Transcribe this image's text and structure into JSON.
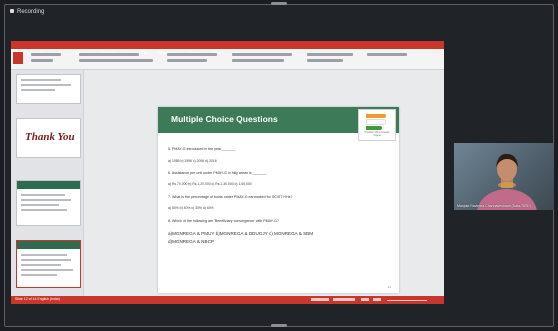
{
  "meeting": {
    "title": "Recording"
  },
  "app": {
    "ribbon_tabs": [
      "File",
      "Home",
      "Insert",
      "Design",
      "Transitions",
      "Animations",
      "Slide Show",
      "Review",
      "View",
      "Help"
    ],
    "status_text": "Slide 12 of 14   English (India)",
    "thanks_text": "Thank You"
  },
  "slide": {
    "title": "Multiple Choice Questions",
    "logo_text": "Pradhan Mantri Awaas Yojana",
    "questions": [
      {
        "text": "5. PMAY-G introduced in the year_______",
        "type": "q"
      },
      {
        "text": "a) 1985  b) 1996  c) 2006  d) 2016",
        "type": "opt"
      },
      {
        "text": "6. Assistance per unit under PMAY-G in hilly areas is _______",
        "type": "q"
      },
      {
        "text": "a) Rs.70,000  b) Rs.1,20,000  c) Rs.1,30,000  d) 1,60,000",
        "type": "opt"
      },
      {
        "text": "7. What is the percentage of funds under PMAY-G earmarked for SC/ST HHs?",
        "type": "q"
      },
      {
        "text": "a) 50%   b) 40%   c) 30%   d) 60%",
        "type": "opt"
      },
      {
        "text": "8. Which of the following are 'Beneficiary convergence' with PMAY-G?",
        "type": "q"
      },
      {
        "text": "a)MGNREGA & PMUY   b)MGNREGA & DDUGJY   c) MGNREGA & SBM",
        "type": "big"
      },
      {
        "text": "d)MGNREGA & NBCP",
        "type": "big"
      }
    ],
    "page": "12"
  },
  "participant": {
    "name": "Manjula Ravindra Channakeshava (Data-SIRD)"
  },
  "colors": {
    "accent": "#c9372c",
    "header_green": "#3d7a57"
  }
}
